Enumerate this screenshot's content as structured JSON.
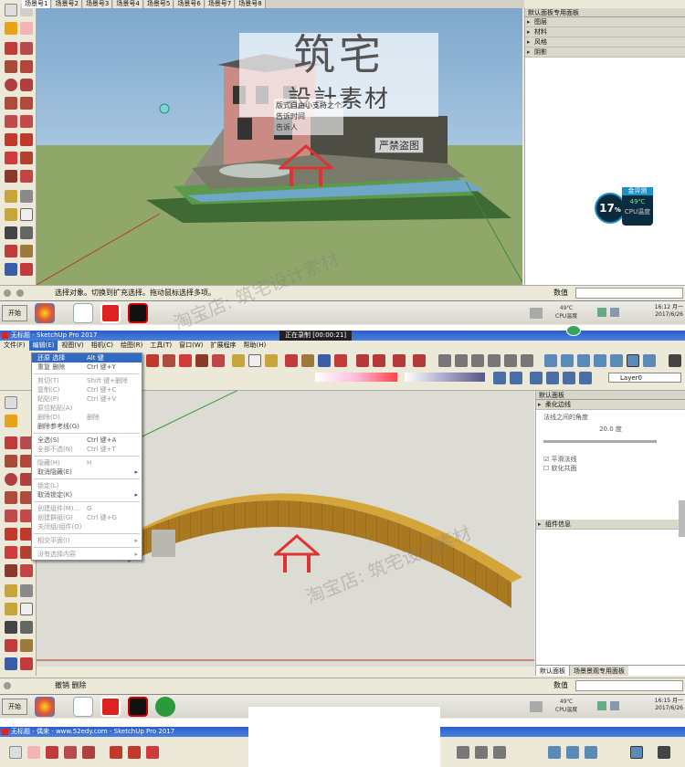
{
  "top": {
    "tabs": [
      "场景号1",
      "场景号2",
      "场景号3",
      "场景号4",
      "场景号5",
      "场景号6",
      "场景号7",
      "场景号8"
    ],
    "tray_title": "默认面板专用面板",
    "tray_sections": [
      "图层",
      "材料",
      "风格",
      "阴影"
    ],
    "status_text": "选择对象。切换到扩充选择。拖动鼠标选择多项。",
    "measure_label": "数值",
    "cpu": {
      "percent": "17",
      "unit": "%",
      "button": "金评测",
      "temp": "49℃",
      "label": "CPU温度"
    },
    "taskbar": {
      "start": "开始",
      "cpu_temp": "49℃",
      "cpu_label": "CPU温度",
      "time": "16:12 月一",
      "date": "2017/6/26"
    }
  },
  "bottom": {
    "title": "无标题 - SketchUp Pro 2017",
    "recording": "正在录制 [00:00:21]",
    "menu": [
      "文件(F)",
      "编辑(E)",
      "视图(V)",
      "相机(C)",
      "绘图(R)",
      "工具(T)",
      "窗口(W)",
      "扩展程序",
      "帮助(H)"
    ],
    "edit_menu": [
      {
        "label": "还原 选择",
        "shortcut": "Alt 键+Backspace",
        "highlight": true
      },
      {
        "label": "重复 删除",
        "shortcut": "Ctrl 键+Y"
      },
      {
        "sep": true
      },
      {
        "label": "剪切(T)",
        "shortcut": "Shift 键+删除",
        "disabled": true
      },
      {
        "label": "复制(C)",
        "shortcut": "Ctrl 键+C",
        "disabled": true
      },
      {
        "label": "粘贴(P)",
        "shortcut": "Ctrl 键+V",
        "disabled": true
      },
      {
        "label": "原位粘贴(A)",
        "disabled": true
      },
      {
        "label": "删除(D)",
        "shortcut": "删除",
        "disabled": true
      },
      {
        "label": "删除参考线(G)"
      },
      {
        "sep": true
      },
      {
        "label": "全选(S)",
        "shortcut": "Ctrl 键+A"
      },
      {
        "label": "全部不选(N)",
        "shortcut": "Ctrl 键+T",
        "disabled": true
      },
      {
        "sep": true
      },
      {
        "label": "隐藏(H)",
        "shortcut": "H",
        "disabled": true
      },
      {
        "label": "取消隐藏(E)",
        "arrow": true
      },
      {
        "sep": true
      },
      {
        "label": "锁定(L)",
        "disabled": true
      },
      {
        "label": "取消锁定(K)",
        "arrow": true
      },
      {
        "sep": true
      },
      {
        "label": "创建组件(M)...",
        "shortcut": "G",
        "disabled": true
      },
      {
        "label": "创建群组(G)",
        "shortcut": "Ctrl 键+G",
        "disabled": true
      },
      {
        "label": "关闭组/组件(O)",
        "disabled": true
      },
      {
        "sep": true
      },
      {
        "label": "相交平面(I)",
        "arrow": true,
        "disabled": true
      },
      {
        "sep": true
      },
      {
        "label": "没有选择内容",
        "arrow": true,
        "disabled": true
      }
    ],
    "layer": "Layer0",
    "tray_title": "默认面板",
    "tray_section1": "柔化边线",
    "smooth_label": "法线之间的角度",
    "smooth_value": "20.0 度",
    "checkbox1": "平滑法线",
    "checkbox2": "软化共面",
    "tray_section2": "组件信息",
    "tray_tabs": [
      "默认面板",
      "场景景观专用面板"
    ],
    "status_text": "撤销 删除",
    "measure_label": "数值",
    "taskbar": {
      "start": "开始",
      "cpu_temp": "49℃",
      "cpu_label": "CPU温度",
      "time": "16:15 月一",
      "date": "2017/6/26"
    }
  },
  "third": {
    "title": "无标题 - 偶来 - www.52edy.com - SketchUp Pro 2017"
  },
  "watermarks": {
    "big_logo_top": "筑宅",
    "big_logo_bottom": "設計素材",
    "stamp": "严禁盗图",
    "shop": "淘宝店: 筑宅设计素材",
    "overlay_info": [
      "版式自由小支持之个",
      "告诉时间",
      "告诉人"
    ]
  }
}
